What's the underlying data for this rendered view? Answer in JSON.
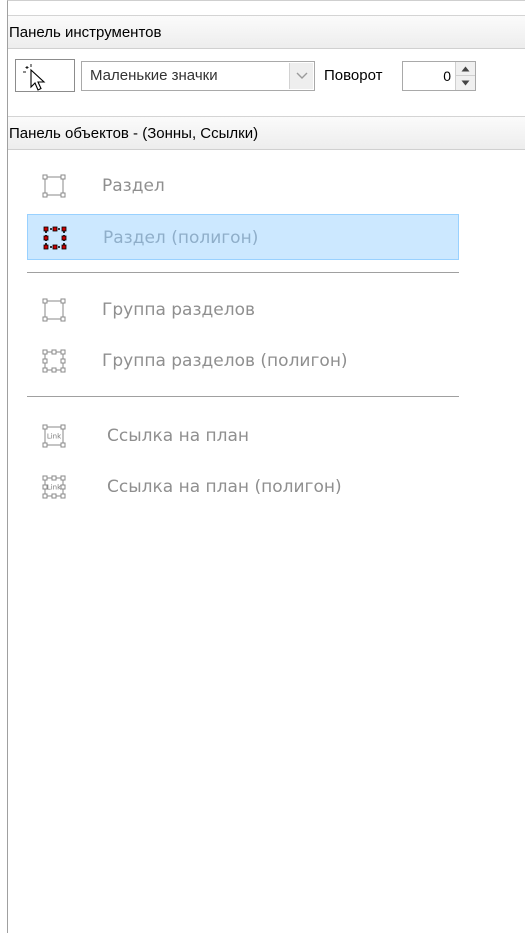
{
  "tools_panel": {
    "title": "Панель инструментов",
    "icon_view_select": {
      "value": "Маленькие значки"
    },
    "rotation": {
      "label": "Поворот",
      "value": "0"
    }
  },
  "objects_panel": {
    "title": "Панель объектов - (Зонны, Ссылки)",
    "items": [
      {
        "label": "Раздел",
        "icon": "section-rect-icon",
        "selected": false
      },
      {
        "label": "Раздел (полигон)",
        "icon": "section-polygon-icon",
        "selected": true
      },
      {
        "label": "Группа разделов",
        "icon": "section-group-rect-icon",
        "selected": false
      },
      {
        "label": "Группа разделов (полигон)",
        "icon": "section-group-polygon-icon",
        "selected": false
      },
      {
        "label": "Ссылка на план",
        "icon": "plan-link-icon",
        "icon_text": "Link",
        "selected": false
      },
      {
        "label": "Ссылка на план (полигон)",
        "icon": "plan-link-polygon-icon",
        "icon_text": "Link",
        "selected": false
      }
    ]
  },
  "colors": {
    "selection_bg": "#cce8ff",
    "selection_border": "#99d1ff",
    "handle_red": "#cc0000",
    "disabled_text": "#8f8f8f"
  }
}
